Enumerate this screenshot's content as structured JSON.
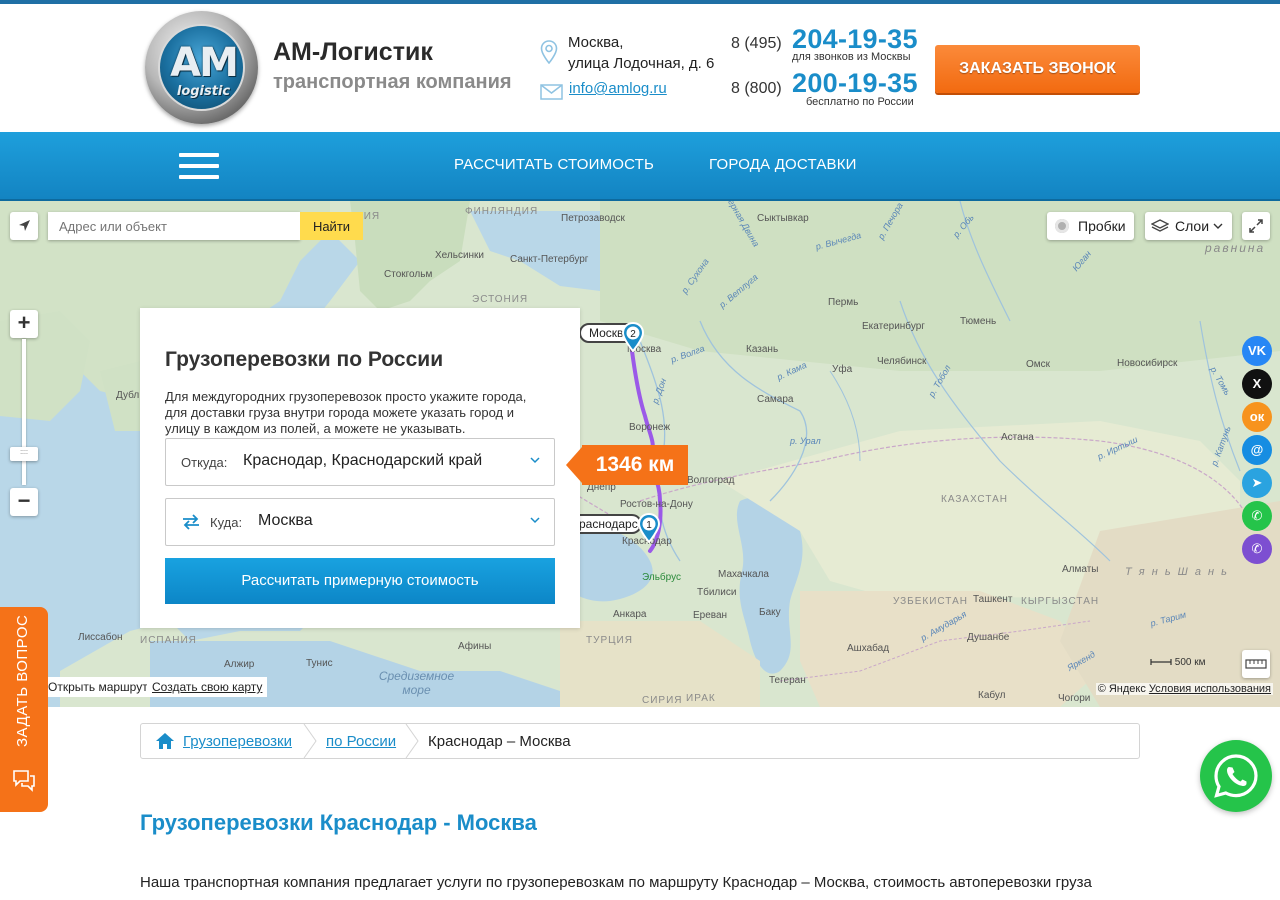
{
  "header": {
    "brand_title": "АМ-Логистик",
    "brand_subtitle": "транспортная компания",
    "logo_text": "AM",
    "logo_subtext": "logistic",
    "address_line1": "Москва,",
    "address_line2": "улица Лодочная, д. 6",
    "email": "info@amlog.ru",
    "phone1_prefix": "8 (495)",
    "phone1_number": "204-19-35",
    "phone1_note": "для звонков из Москвы",
    "phone2_prefix": "8 (800)",
    "phone2_number": "200-19-35",
    "phone2_note": "бесплатно по России",
    "callback_label": "ЗАКАЗАТЬ ЗВОНОК"
  },
  "nav": {
    "items": [
      {
        "label": "РАССЧИТАТЬ СТОИМОСТЬ"
      },
      {
        "label": "ГОРОДА ДОСТАВКИ"
      }
    ]
  },
  "map": {
    "search_placeholder": "Адрес или объект",
    "find_label": "Найти",
    "traffic_label": "Пробки",
    "layers_label": "Слои",
    "zoom_in": "+",
    "zoom_out": "−",
    "distance": "1346 км",
    "marker_from": "1",
    "marker_to": "2",
    "tag_to": "Москва",
    "tag_from": "Краснодарский край",
    "open_route_label": "Открыть маршрут",
    "create_map_label": "Создать свою карту",
    "copyright": "© Яндекс",
    "terms_label": "Условия использования",
    "scale_label": "500 км",
    "labels": {
      "helsinki": "Хельсинки",
      "spb": "Санкт-Петербург",
      "stockholm": "Стокгольм",
      "petrozavodsk": "Петрозаводск",
      "syktyvkar": "Сыктывкар",
      "perm": "Пермь",
      "ekb": "Екатеринбург",
      "tyumen": "Тюмень",
      "kazan": "Казань",
      "ufa": "Уфа",
      "chelyabinsk": "Челябинск",
      "omsk": "Омск",
      "novosibirsk": "Новосибирск",
      "samara": "Самара",
      "voronezh": "Воронеж",
      "volgograd": "Волгоград",
      "rostov": "Ростов-на-Дону",
      "dnepr": "Днепр",
      "astana": "Астана",
      "kazakhstan": "КАЗАХСТАН",
      "makhachkala": "Махачкала",
      "tbilisi": "Тбилиси",
      "erevan": "Ереван",
      "baku": "Баку",
      "uzbekistan": "УЗБЕКИСТАН",
      "tashkent": "Ташкент",
      "kyrgyzstan": "КЫРГЫЗСТАН",
      "almaty": "Алматы",
      "dushanbe": "Душанбе",
      "ashgabat": "Ашхабад",
      "tehran": "Тегеран",
      "kabul": "Кабул",
      "turkey": "ТУРЦИЯ",
      "ankara": "Анкара",
      "lisbon": "Лиссабон",
      "algiers": "Алжир",
      "tunis": "Тунис",
      "athens": "Афины",
      "mediterranean": "Средиземное море",
      "estonia": "ЭСТОНИЯ",
      "sweden": "ВЕЦИЯ",
      "finland": "ФИНЛЯНДИЯ",
      "elbrus": "Эльбрус",
      "krasnodar": "Краснодар",
      "moscow_city": "Москва",
      "dublin": "Дубл",
      "spain": "ИСПАНИЯ",
      "iraq": "ИРАК",
      "syria": "СИРИЯ",
      "chogori": "Чогори",
      "tien_shan": "Т я н ь   Ш а н ь",
      "ravnina": "равнина",
      "r_ural": "р. Урал",
      "r_don": "р. Дон",
      "r_volga": "р. Волга",
      "r_kama": "р. Кама",
      "r_ob": "р. Обь",
      "r_irtysh": "р. Иртыш",
      "r_tobol": "р. Тобол",
      "r_pechora": "р. Печора",
      "r_vetluga": "р. Ветлуга",
      "r_sukhona": "р. Сухона",
      "r_tom": "р. Томь",
      "r_katun": "р. Катунь",
      "r_tarim": "р. Тарим",
      "r_amudarya": "р. Амударья",
      "yarkend": "Яркенд",
      "severnaya_dvina": "Северная Двина",
      "r_vychegda": "р. Вычегда",
      "r_yugan": "Юган"
    }
  },
  "route_panel": {
    "title": "Грузоперевозки по России",
    "description": "Для междугородних грузоперевозок просто укажите города, для доставки груза внутри города можете указать город и улицу в каждом из полей, а можете не указывать.",
    "from_label": "Откуда:",
    "from_value": "Краснодар, Краснодарский край",
    "to_label": "Куда:",
    "to_value": "Москва",
    "calc_button": "Рассчитать примерную стоимость"
  },
  "social": [
    {
      "name": "vk",
      "label": "VK",
      "color": "#2787f5"
    },
    {
      "name": "x",
      "label": "X",
      "color": "#111111"
    },
    {
      "name": "ok",
      "label": "ок",
      "color": "#f7931e"
    },
    {
      "name": "mail",
      "label": "@",
      "color": "#168de2"
    },
    {
      "name": "telegram",
      "label": "➤",
      "color": "#2aa3e0"
    },
    {
      "name": "whatsapp",
      "label": "✆",
      "color": "#25c44a"
    },
    {
      "name": "viber",
      "label": "✆",
      "color": "#7d4fd1"
    }
  ],
  "ask_question": "ЗАДАТЬ ВОПРОС",
  "breadcrumbs": {
    "item1": "Грузоперевозки",
    "item2": "по России",
    "current": "Краснодар – Москва"
  },
  "content": {
    "heading": "Грузоперевозки Краснодар - Москва",
    "paragraph": "Наша транспортная компания предлагает услуги по грузоперевозкам по маршруту Краснодар – Москва, стоимость автоперевозки груза"
  },
  "colors": {
    "accent": "#1a8dc9",
    "orange": "#f57218",
    "nav_blue": "#1892d0"
  }
}
